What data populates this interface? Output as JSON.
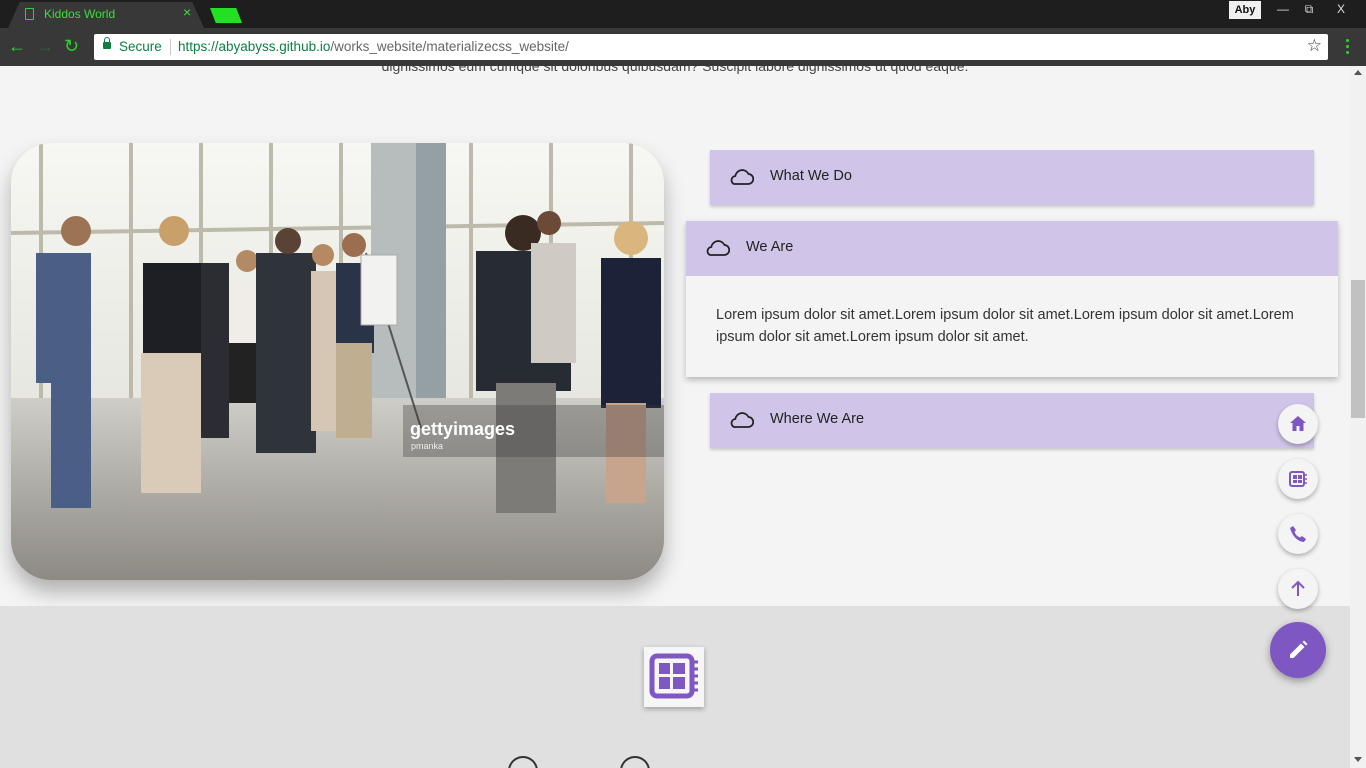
{
  "browser": {
    "tab_title": "Kiddos World",
    "tab_close": "×",
    "profile": "Aby",
    "window_buttons": {
      "minimize": "—",
      "maximize": "⧉",
      "close": "X"
    },
    "secure_label": "Secure",
    "url_host": "https://abyabyss.github.io",
    "url_path": "/works_website/materializecss_website/",
    "star": "☆",
    "nav": {
      "back": "←",
      "forward": "→",
      "reload": "↻"
    }
  },
  "page": {
    "cut_text": "dignissimos eum cumque sit doloribus quibusdam? Suscipit labore dignissimos ut quod eaque.",
    "image_alt": "Business people talking in an office lobby",
    "photo_watermark": "gettyimages",
    "photo_credit": "pmanka",
    "accordion": [
      {
        "title": "What We Do"
      },
      {
        "title": "We Are",
        "body": "Lorem ipsum dolor sit amet.Lorem ipsum dolor sit amet.Lorem ipsum dolor sit amet.Lorem ipsum dolor sit amet.Lorem ipsum dolor sit amet."
      },
      {
        "title": "Where We Are"
      }
    ],
    "accordion_icon": "cloud-icon"
  },
  "fab_menu": {
    "items": [
      "home-icon",
      "newspaper-icon",
      "phone-icon",
      "arrow-up-icon",
      "arrow-down-icon"
    ],
    "main": "edit-icon"
  },
  "colors": {
    "accent": "#7e57c2",
    "header": "#d1c4e9",
    "band": "#e0e0e0"
  }
}
